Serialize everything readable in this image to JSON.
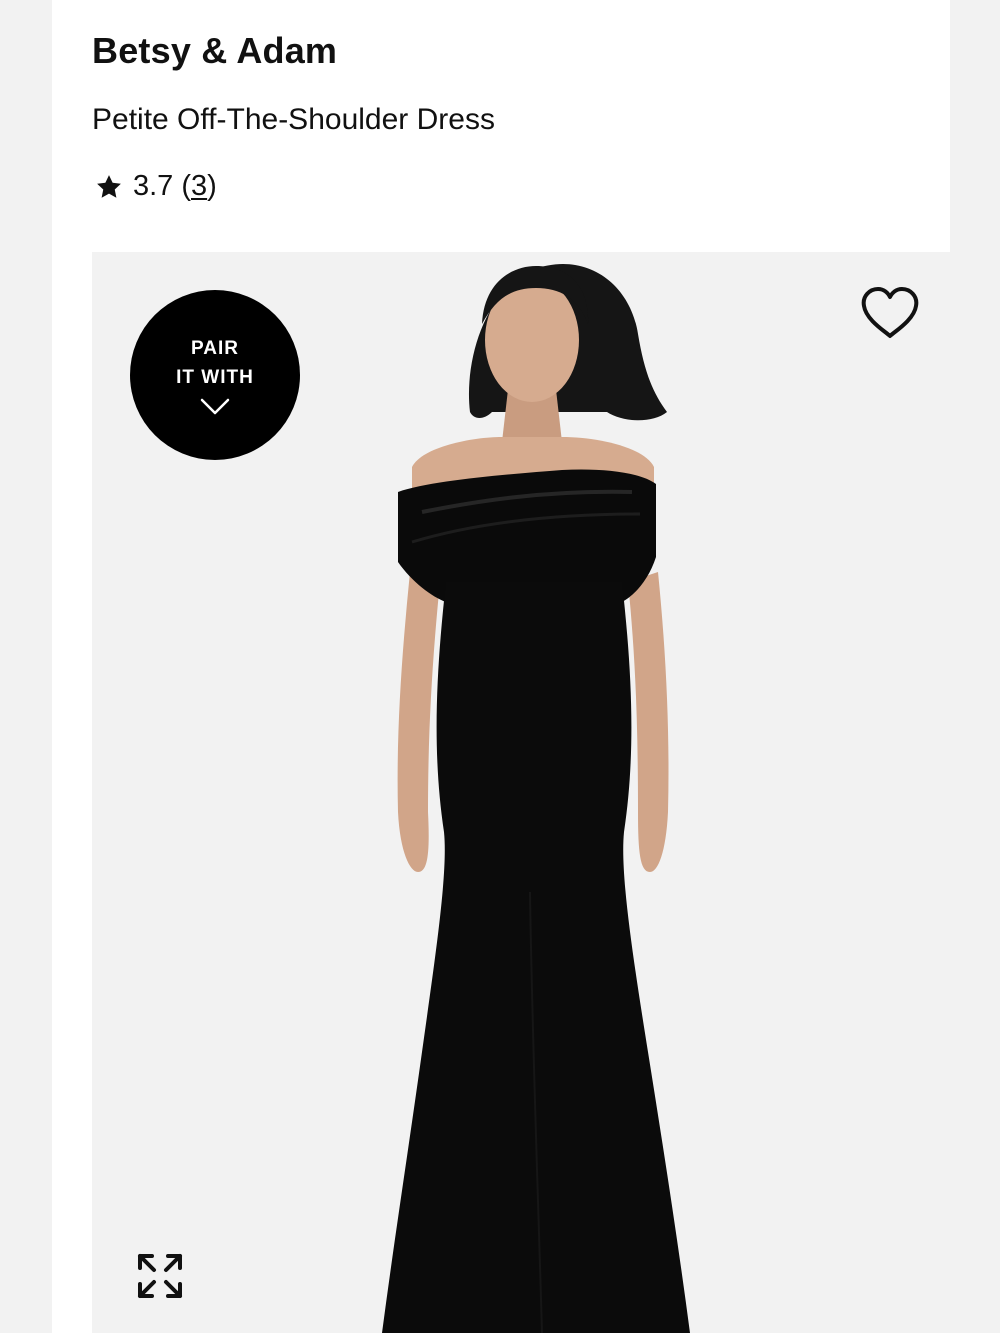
{
  "product": {
    "brand": "Betsy & Adam",
    "name": "Petite Off-The-Shoulder Dress",
    "rating": {
      "score": "3.7",
      "open_paren": "(",
      "count": "3",
      "close_paren": ")",
      "icon": "star-icon"
    }
  },
  "media": {
    "pair_badge": {
      "line1": "PAIR",
      "line2": "IT WITH",
      "icon": "chevron-down-icon"
    },
    "wishlist_icon": "heart-icon",
    "expand_icon": "expand-icon",
    "colors": {
      "badge_bg": "#000000",
      "image_bg": "#f2f2f2",
      "dress": "#0b0b0b",
      "skin": "#d6ab8f"
    }
  }
}
